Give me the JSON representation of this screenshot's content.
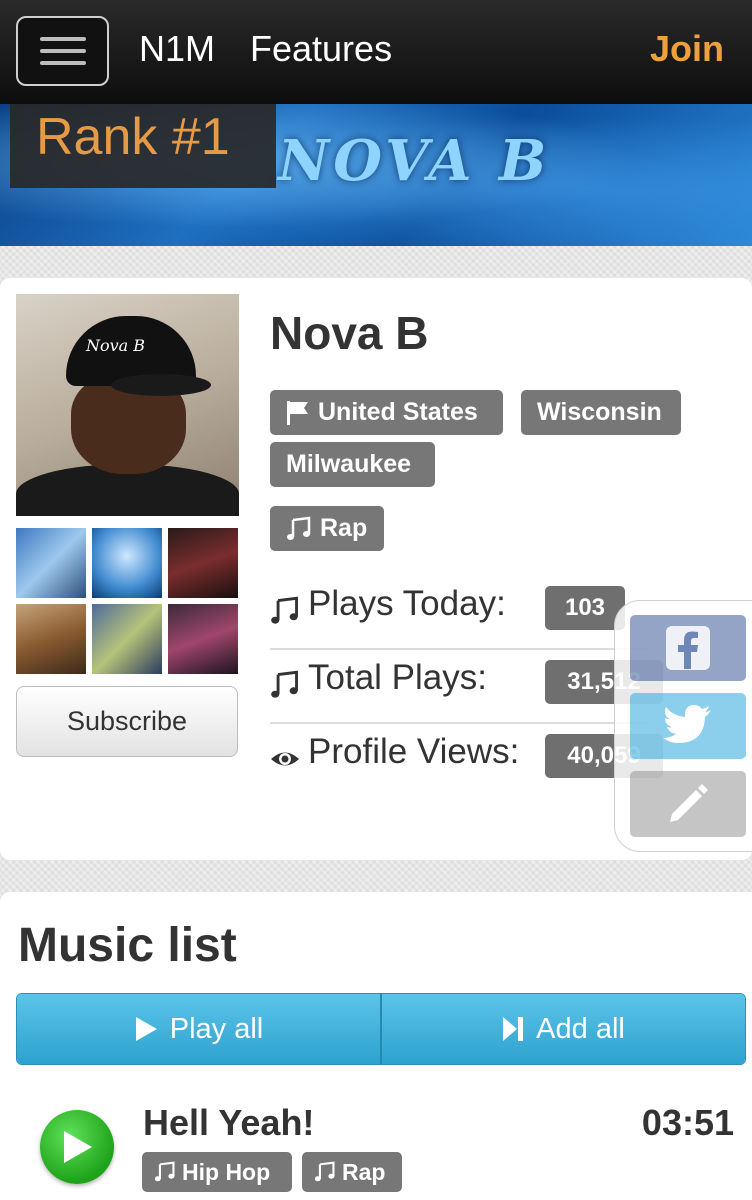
{
  "nav": {
    "brand": "N1M",
    "features": "Features",
    "join": "Join"
  },
  "banner": {
    "text": "NOVA B",
    "rank": "Rank #1"
  },
  "profile": {
    "name": "Nova B",
    "photo_cap_text": "Nova B",
    "tags": {
      "country": "United States",
      "state": "Wisconsin",
      "city": "Milwaukee",
      "genre": "Rap"
    },
    "stats": [
      {
        "label": "Plays Today:",
        "value": "103",
        "icon": "music-note-icon"
      },
      {
        "label": "Total Plays:",
        "value": "31,512",
        "icon": "music-note-icon"
      },
      {
        "label": "Profile Views:",
        "value": "40,059",
        "icon": "eye-icon"
      }
    ],
    "subscribe_label": "Subscribe"
  },
  "social": [
    "facebook-icon",
    "twitter-icon",
    "pencil-icon"
  ],
  "music": {
    "title": "Music list",
    "play_all": "Play all",
    "add_all": "Add all",
    "tracks": [
      {
        "title": "Hell Yeah!",
        "duration": "03:51",
        "tags": [
          "Hip Hop",
          "Rap"
        ]
      }
    ]
  },
  "colors": {
    "accent_orange": "#f0a03a",
    "button_blue": "#2da2cf",
    "tag_gray": "#777777",
    "play_green": "#1fa31b"
  }
}
